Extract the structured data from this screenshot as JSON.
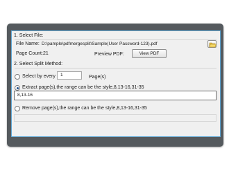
{
  "select_file": {
    "section_label": "1. Select File:",
    "file_name_label": "File Name:",
    "file_name_value": "D:\\pample\\pdfmergesplit\\Sample(User Password-123).pdf",
    "page_count_label": "Page Count:",
    "page_count_value": "21",
    "preview_label": "Preview PDF:",
    "view_button_label": "View PDF",
    "browse_icon": "folder-open-icon"
  },
  "split_method": {
    "section_label": "2. Select Split Method:",
    "select_every": {
      "label": "Select by every",
      "value": "1",
      "unit": "Page(s)",
      "selected": false
    },
    "extract": {
      "label": "Extract page(s),the range can be the style,8,13-16,31-35",
      "value": "8,13-16",
      "selected": true
    },
    "remove": {
      "label": "Remove page(s),the range can be the style,8,13-16,31-35",
      "selected": false
    }
  },
  "colors": {
    "frame": "#555a5e",
    "panel": "#f0f0f0",
    "panel_border": "#5fa8d6",
    "radio_dot": "#1f4e8a"
  }
}
